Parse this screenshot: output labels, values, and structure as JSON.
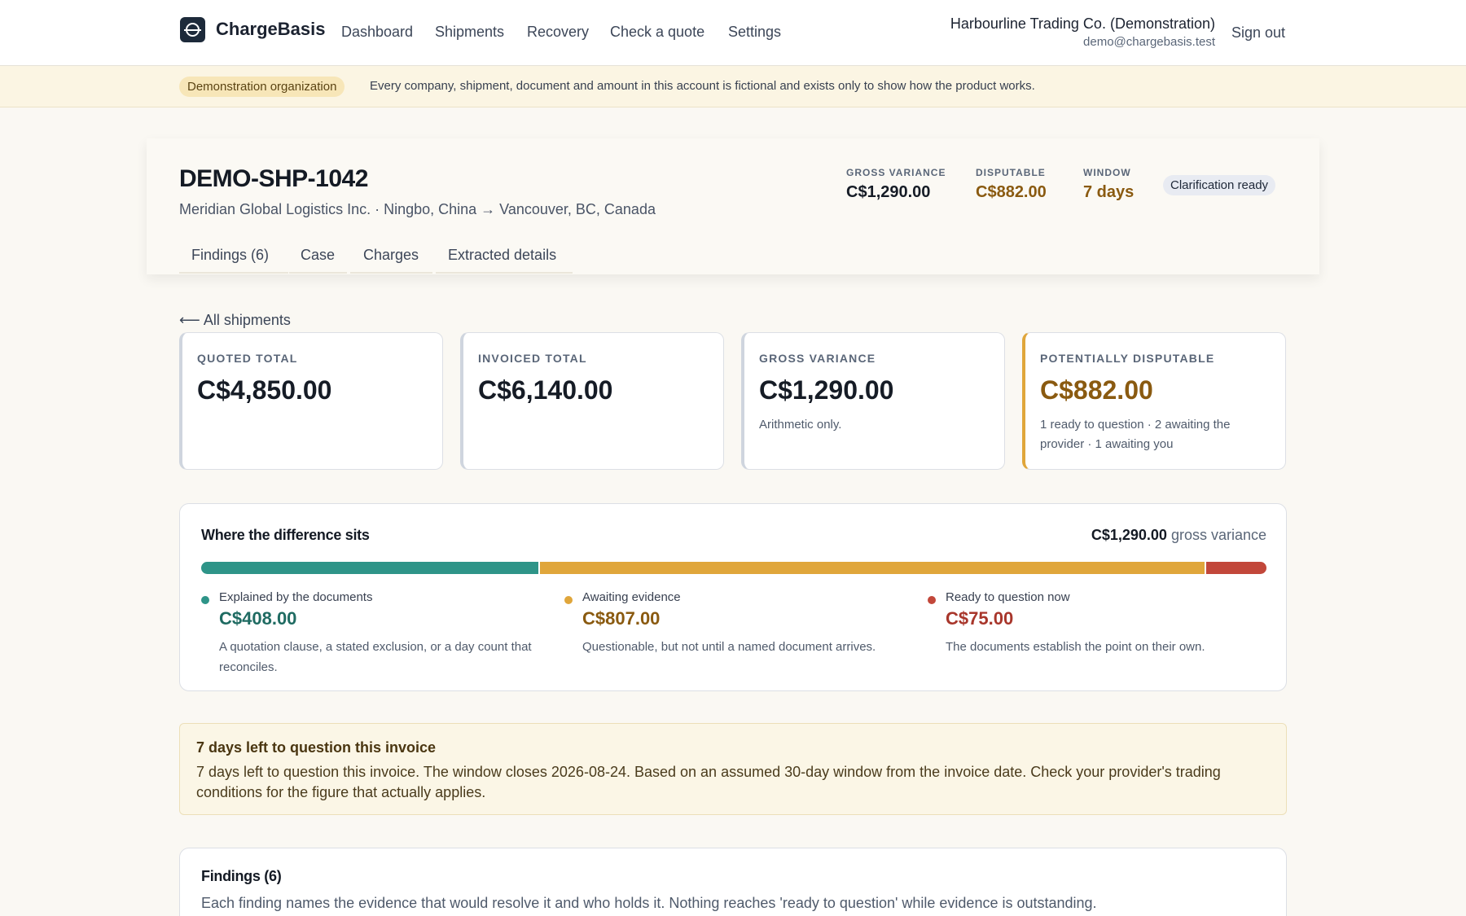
{
  "app": {
    "name": "ChargeBasis",
    "nav": [
      "Dashboard",
      "Shipments",
      "Recovery",
      "Check a quote",
      "Settings"
    ],
    "org_name": "Harbourline Trading Co. (Demonstration)",
    "user_email": "demo@chargebasis.test",
    "sign_out": "Sign out"
  },
  "banner": {
    "pill": "Demonstration organization",
    "text": "Every company, shipment, document and amount in this account is fictional and exists only to show how the product works."
  },
  "shipment": {
    "id": "DEMO-SHP-1042",
    "subtitle": "Meridian Global Logistics Inc. · Ningbo, China → Vancouver, BC, Canada",
    "kpis": [
      {
        "label": "GROSS VARIANCE",
        "value": "C$1,290.00",
        "color": "#161c26"
      },
      {
        "label": "DISPUTABLE",
        "value": "C$882.00",
        "color": "#8a5a10"
      },
      {
        "label": "WINDOW",
        "value": "7 days",
        "color": "#8a5a10"
      }
    ],
    "status": "Clarification ready",
    "tabs": [
      "Findings (6)",
      "Case",
      "Charges",
      "Extracted details"
    ]
  },
  "back_link": "⟵ All shipments",
  "cards": [
    {
      "label": "QUOTED TOTAL",
      "value": "C$4,850.00",
      "note": ""
    },
    {
      "label": "INVOICED TOTAL",
      "value": "C$6,140.00",
      "note": ""
    },
    {
      "label": "GROSS VARIANCE",
      "value": "C$1,290.00",
      "note": "Arithmetic only."
    },
    {
      "label": "POTENTIALLY DISPUTABLE",
      "value": "C$882.00",
      "note": "1 ready to question · 2 awaiting the provider · 1 awaiting you"
    }
  ],
  "difference": {
    "title": "Where the difference sits",
    "total_value": "C$1,290.00",
    "total_suffix": "gross variance",
    "segments": [
      {
        "label": "Explained by the documents",
        "value": "C$408.00",
        "amount": 408,
        "color": "#2e9488",
        "text_color": "#1f6b62",
        "note": "A quotation clause, a stated exclusion, or a day count that reconciles."
      },
      {
        "label": "Awaiting evidence",
        "value": "C$807.00",
        "amount": 807,
        "color": "#e0a63b",
        "text_color": "#8a5a10",
        "note": "Questionable, but not until a named document arrives."
      },
      {
        "label": "Ready to question now",
        "value": "C$75.00",
        "amount": 75,
        "color": "#c2473a",
        "text_color": "#a8362b",
        "note": "The documents establish the point on their own."
      }
    ]
  },
  "window_notice": {
    "title": "7 days left to question this invoice",
    "body": "7 days left to question this invoice. The window closes 2026-08-24. Based on an assumed 30-day window from the invoice date. Check your provider's trading conditions for the figure that actually applies."
  },
  "findings": {
    "title": "Findings (6)",
    "body": "Each finding names the evidence that would resolve it and who holds it. Nothing reaches 'ready to question' while evidence is outstanding."
  }
}
